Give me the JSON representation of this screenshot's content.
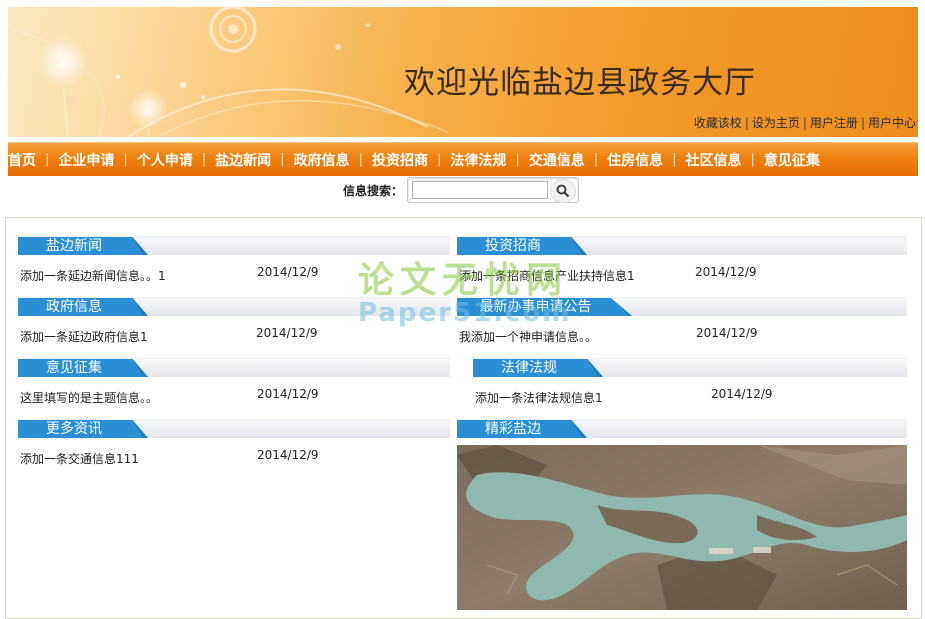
{
  "banner": {
    "title": "欢迎光临盐边县政务大厅",
    "links": [
      "收藏该校",
      "设为主页",
      "用户注册",
      "用户中心"
    ],
    "link_separator": "|"
  },
  "nav": {
    "items": [
      "首页",
      "企业申请",
      "个人申请",
      "盐边新闻",
      "政府信息",
      "投资招商",
      "法律法规",
      "交通信息",
      "住房信息",
      "社区信息",
      "意见征集"
    ],
    "separator": "|"
  },
  "search": {
    "label": "信息搜索：",
    "value": ""
  },
  "sections": {
    "yanbian_news": {
      "title": "盐边新闻",
      "items": [
        {
          "title": "添加一条延边新闻信息。。1",
          "date": "2014/12/9"
        }
      ]
    },
    "investment": {
      "title": "投资招商",
      "items": [
        {
          "title": "添加一条招商信息产业扶持信息1",
          "date": "2014/12/9"
        }
      ]
    },
    "gov_info": {
      "title": "政府信息",
      "items": [
        {
          "title": "添加一条延边政府信息1",
          "date": "2014/12/9"
        }
      ]
    },
    "latest_apply": {
      "title": "最新办事申请公告",
      "items": [
        {
          "title": "我添加一个神申请信息。。",
          "date": "2014/12/9"
        }
      ]
    },
    "opinions": {
      "title": "意见征集",
      "items": [
        {
          "title": "这里填写的是主题信息。。",
          "date": "2014/12/9"
        }
      ]
    },
    "law": {
      "title": "法律法规",
      "items": [
        {
          "title": "添加一条法律法规信息1",
          "date": "2014/12/9"
        }
      ]
    },
    "more_news": {
      "title": "更多资讯",
      "items": [
        {
          "title": "添加一条交通信息111",
          "date": "2014/12/9"
        }
      ]
    },
    "scenery": {
      "title": "精彩盐边"
    }
  },
  "watermark": {
    "cn": "论文无忧网",
    "en": "Paper51.com"
  },
  "colors": {
    "nav_orange": "#ee7f0e",
    "tab_blue": "#2b8fd6",
    "banner_orange": "#f29a2a"
  }
}
